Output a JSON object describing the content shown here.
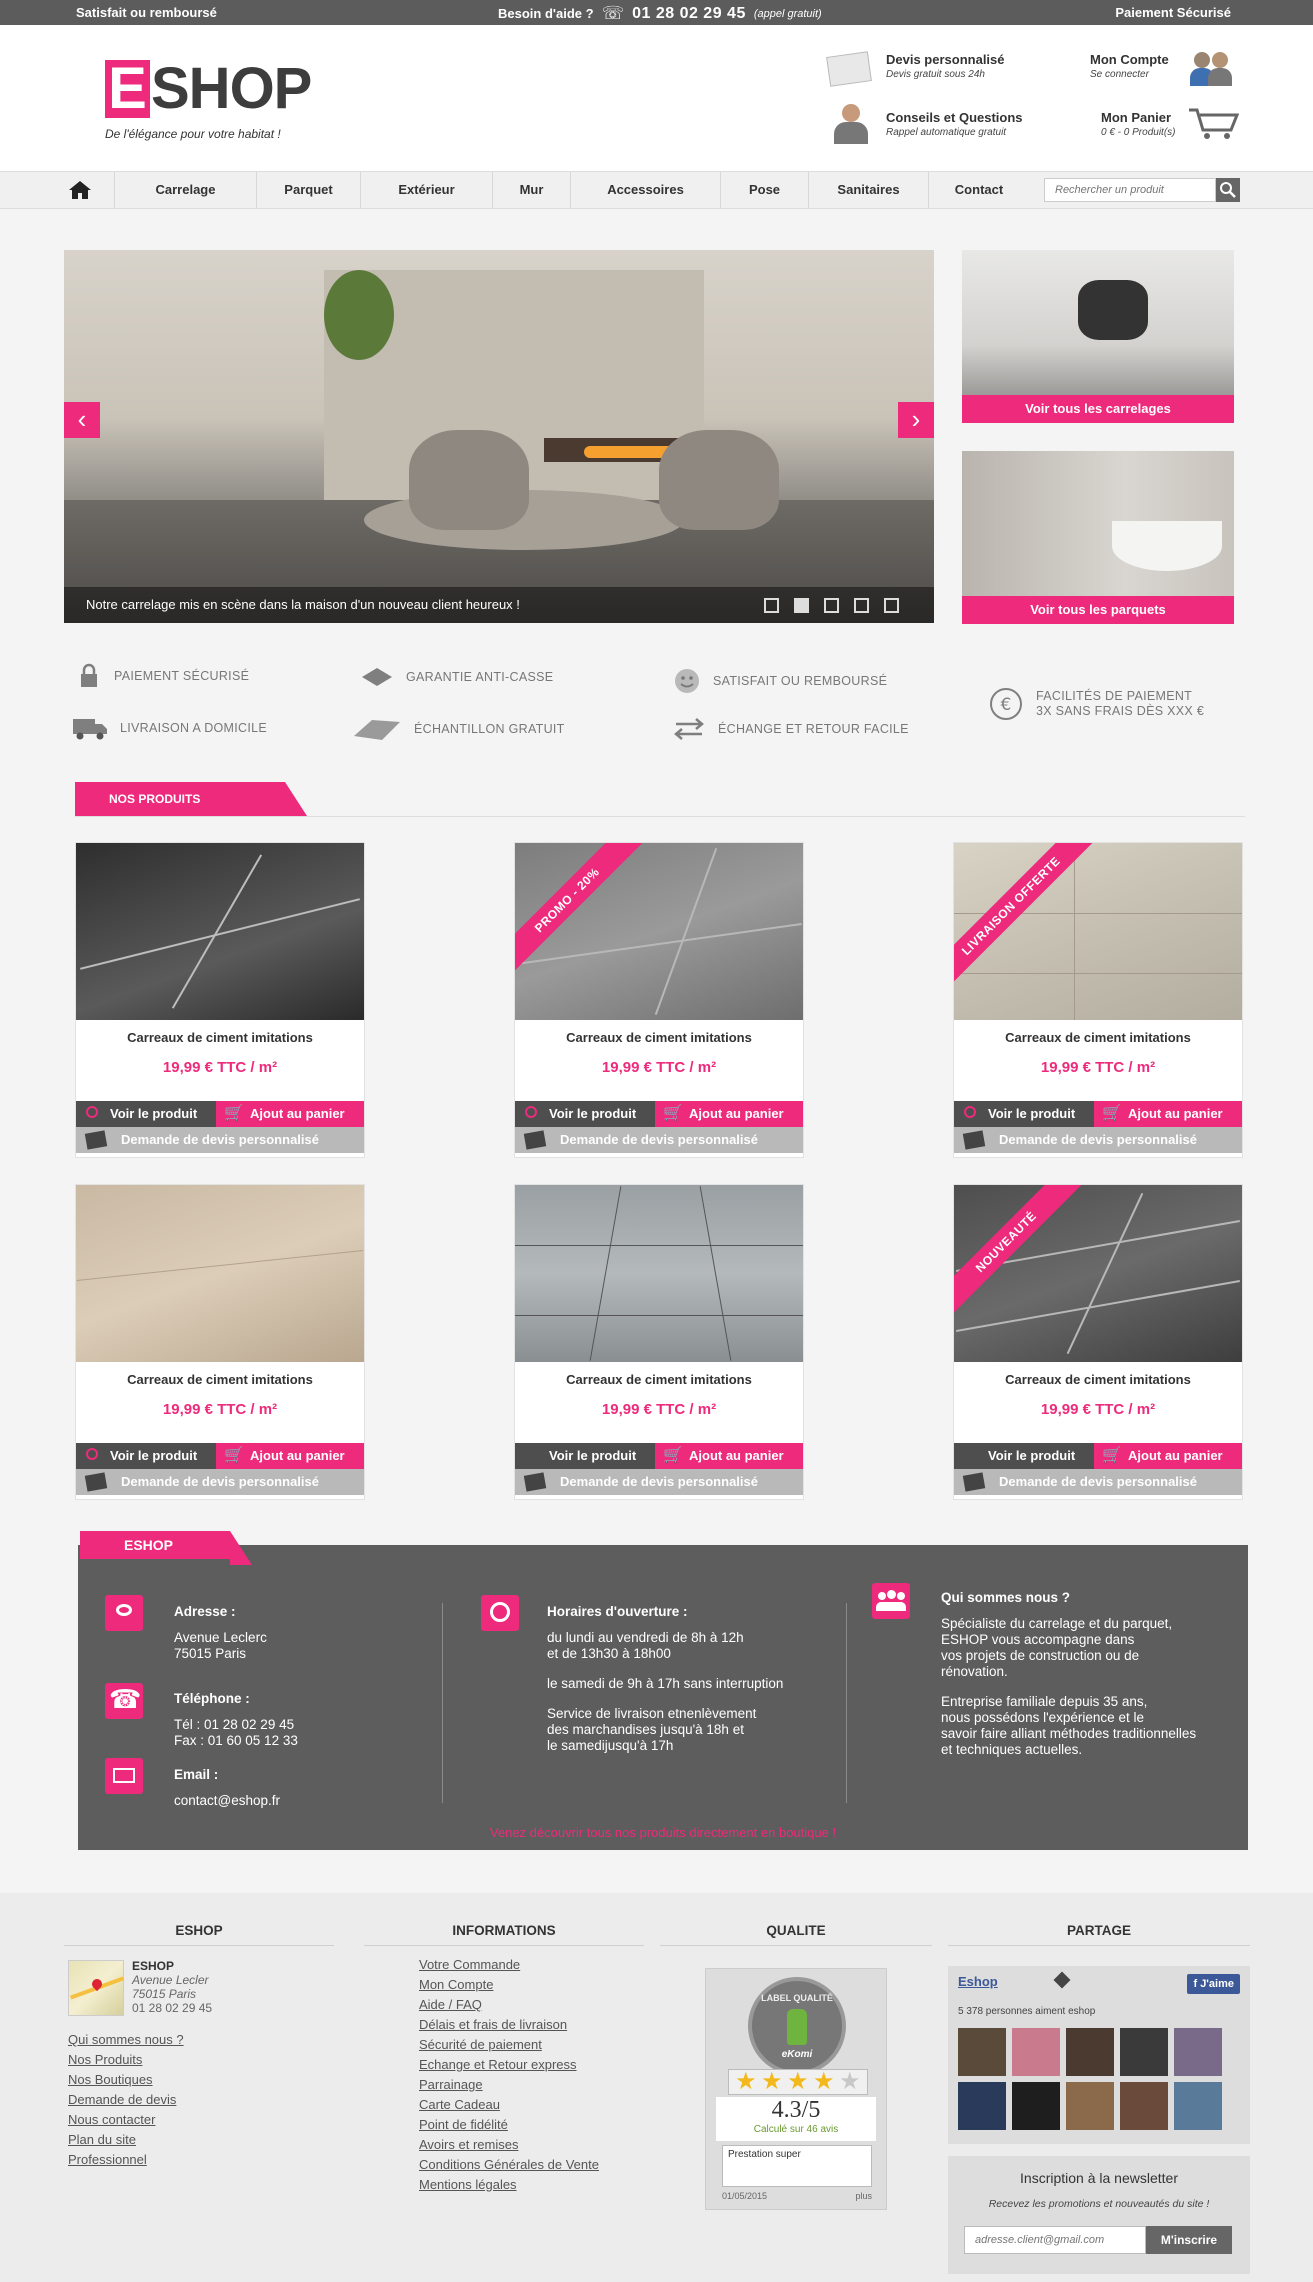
{
  "topbar": {
    "guarantee": "Satisfait ou remboursé",
    "help_label": "Besoin d'aide ?",
    "phone": "01 28 02 29 45",
    "phone_note": "(appel gratuit)",
    "secure": "Paiement Sécurisé"
  },
  "header": {
    "logo_letter": "E",
    "logo_rest": "SHOP",
    "tagline": "De l'élégance pour votre habitat !",
    "quote_title": "Devis personnalisé",
    "quote_sub": "Devis gratuit sous 24h",
    "account_title": "Mon Compte",
    "account_sub": "Se connecter",
    "advice_title": "Conseils et Questions",
    "advice_sub": "Rappel automatique gratuit",
    "cart_title": "Mon Panier",
    "cart_sub": "0 € - 0 Produit(s)"
  },
  "nav": {
    "items": [
      "Carrelage",
      "Parquet",
      "Extérieur",
      "Mur",
      "Accessoires",
      "Pose",
      "Sanitaires",
      "Contact"
    ],
    "search_placeholder": "Rechercher un produit"
  },
  "hero": {
    "caption": "Notre carrelage mis en scène dans la maison d'un nouveau client heureux !",
    "prev": "‹",
    "next": "›",
    "slide_count": 5,
    "active_slide": 2
  },
  "side_banners": {
    "tiles": "Voir tous les carrelages",
    "parquet": "Voir tous les parquets"
  },
  "features": {
    "secure": "PAIEMENT SÉCURISÉ",
    "guarantee": "GARANTIE ANTI-CASSE",
    "satisfied": "SATISFAIT OU REMBOURSÉ",
    "payment_1": "FACILITÉS DE PAIEMENT",
    "payment_2": "3X SANS FRAIS DÈS XXX €",
    "delivery": "LIVRAISON A DOMICILE",
    "sample": "ÉCHANTILLON GRATUIT",
    "exchange": "ÉCHANGE ET RETOUR FACILE"
  },
  "products_tab": "NOS PRODUITS",
  "products": [
    {
      "name": "Carreaux de ciment imitations",
      "price": "19,99 € TTC / m²",
      "ribbon": ""
    },
    {
      "name": "Carreaux de ciment imitations",
      "price": "19,99 € TTC / m²",
      "ribbon": "PROMO - 20%"
    },
    {
      "name": "Carreaux de ciment imitations",
      "price": "19,99 € TTC / m²",
      "ribbon": "LIVRAISON OFFERTE"
    },
    {
      "name": "Carreaux de ciment imitations",
      "price": "19,99 € TTC / m²",
      "ribbon": ""
    },
    {
      "name": "Carreaux de ciment imitations",
      "price": "19,99 € TTC / m²",
      "ribbon": ""
    },
    {
      "name": "Carreaux de ciment imitations",
      "price": "19,99 € TTC / m²",
      "ribbon": "NOUVEAUTÉ"
    }
  ],
  "product_buttons": {
    "view": "Voir le produit",
    "cart": "Ajout au panier",
    "quote": "Demande de devis personnalisé"
  },
  "info": {
    "tab": "ESHOP",
    "address_title": "Adresse :",
    "address_1": "Avenue Leclerc",
    "address_2": "75015 Paris",
    "phone_title": "Téléphone :",
    "tel": "Tél : 01 28 02 29 45",
    "fax": "Fax : 01 60 05 12 33",
    "email_title": "Email :",
    "email": "contact@eshop.fr",
    "hours_title": "Horaires d'ouverture :",
    "hours_1": "du lundi au vendredi de 8h à 12h",
    "hours_2": "et de 13h30 à 18h00",
    "hours_3": "le samedi de 9h à 17h sans interruption",
    "hours_4": "Service de livraison etnenlèvement",
    "hours_5": "des marchandises jusqu'à 18h et",
    "hours_6": "le samedijusqu'à 17h",
    "about_title": "Qui sommes nous ?",
    "about_1": "Spécialiste du carrelage et du parquet,",
    "about_2": "ESHOP vous accompagne dans",
    "about_3": "vos projets de construction ou de",
    "about_4": "rénovation.",
    "about_5": "Entreprise familiale depuis 35 ans,",
    "about_6": "nous possédons l'expérience et le",
    "about_7": "savoir faire alliant méthodes traditionnelles",
    "about_8": "et techniques actuelles.",
    "cta": "Venez découvrir tous nos produits directement en boutique !"
  },
  "footer": {
    "col1_title": "ESHOP",
    "shop_name": "ESHOP",
    "shop_addr_1": "Avenue Lecler",
    "shop_addr_2": "75015 Paris",
    "shop_phone": "01 28 02 29 45",
    "col1_links": [
      "Qui sommes nous ?",
      "Nos Produits",
      "Nos Boutiques",
      "Demande de devis",
      "Nous contacter",
      "Plan du site",
      "Professionnel"
    ],
    "col2_title": "INFORMATIONS",
    "col2_links": [
      "Votre Commande",
      "Mon Compte",
      "Aide / FAQ",
      "Délais et frais de livraison",
      "Sécurité de paiement",
      "Echange et Retour express",
      "Parrainage",
      "Carte Cadeau",
      "Point de fidélité",
      "Avoirs et remises",
      "Conditions Générales de Vente",
      "Mentions légales"
    ],
    "col3_title": "QUALITE",
    "label_text": "LABEL QUALITÉ",
    "label_brand": "eKomi",
    "rating": "4.3/5",
    "rating_sub": "Calculé sur 46 avis",
    "rating_stars": 4.3,
    "review": "Prestation super",
    "review_date": "01/05/2015",
    "review_more": "plus",
    "col4_title": "PARTAGE",
    "fb_name": "Eshop",
    "fb_like": "J'aime",
    "fb_count": "5 378 personnes aiment eshop",
    "newsletter_title": "Inscription à la newsletter",
    "newsletter_sub": "Recevez les promotions et nouveautés du site !",
    "newsletter_placeholder": "adresse.client@gmail.com",
    "newsletter_btn": "M'inscrire"
  },
  "colors": {
    "accent": "#ed2a7b",
    "dark": "#5d5d5d"
  }
}
